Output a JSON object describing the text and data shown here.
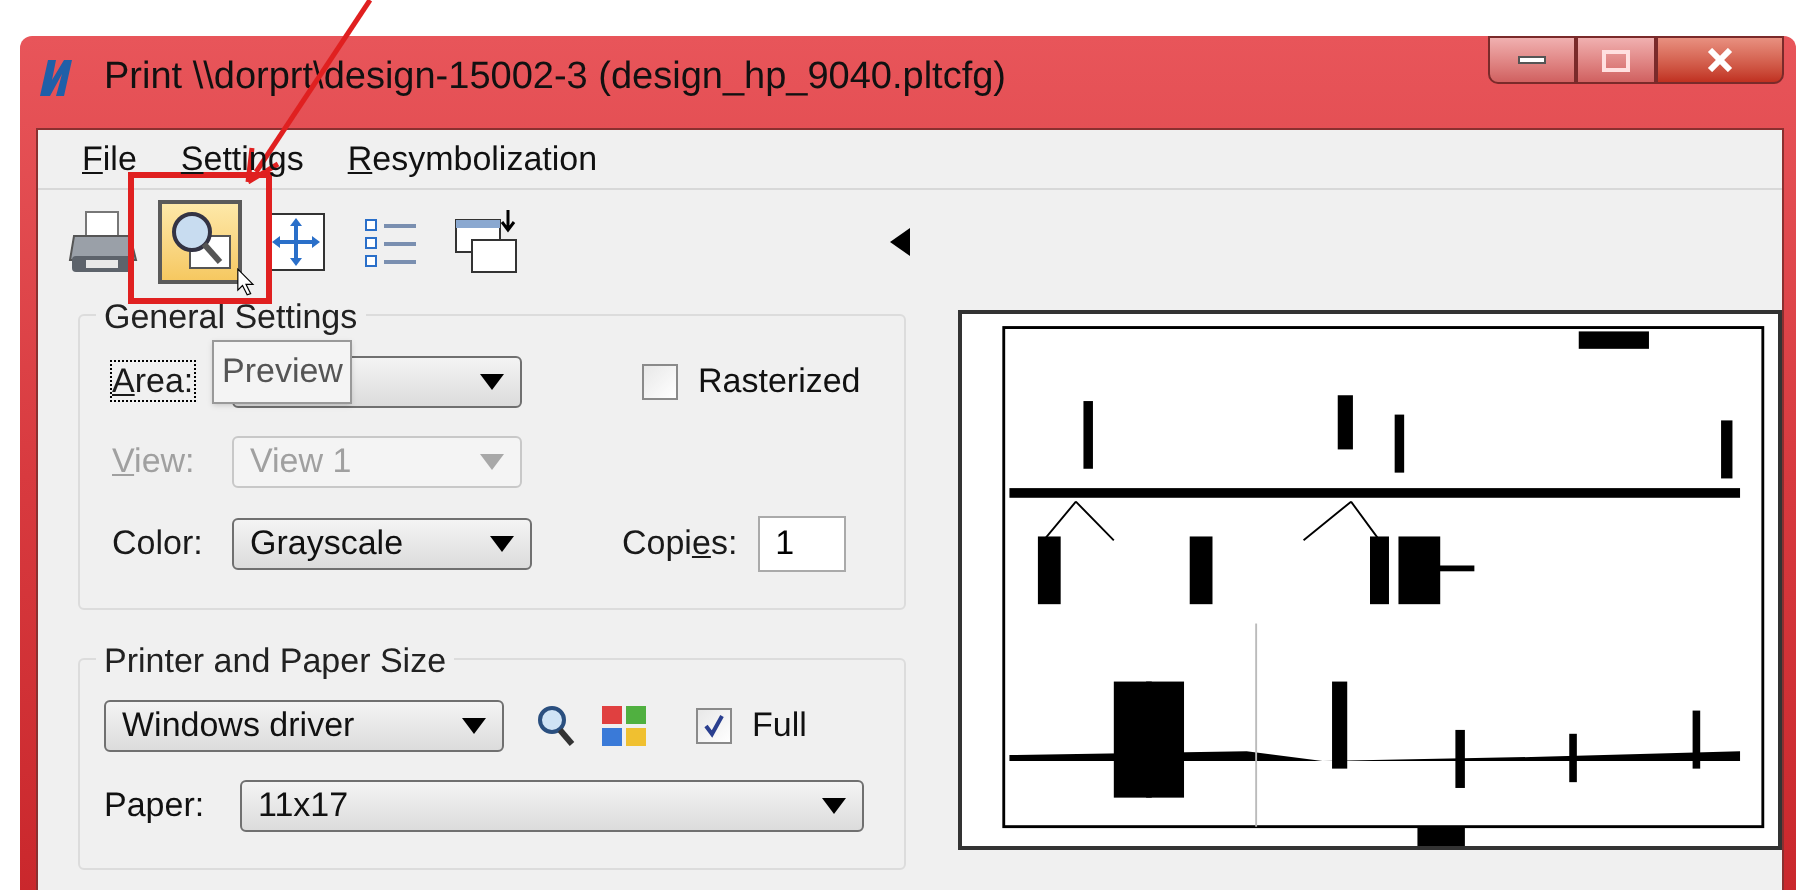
{
  "window": {
    "title": "Print  \\\\dorprt\\design-15002-3  (design_hp_9040.pltcfg)"
  },
  "menu": [
    {
      "key": "F",
      "rest": "ile"
    },
    {
      "key": "S",
      "rest": "ettings"
    },
    {
      "key": "R",
      "rest": "esymbolization"
    }
  ],
  "toolbar": [
    {
      "kind": "print",
      "selected": false
    },
    {
      "kind": "preview",
      "selected": true
    },
    {
      "kind": "fit",
      "selected": false
    },
    {
      "kind": "list",
      "selected": false
    },
    {
      "kind": "swap",
      "selected": false
    }
  ],
  "tooltip": "Preview",
  "general_settings": {
    "title": "General Settings",
    "area": {
      "label": {
        "key": "A",
        "after": "rea:"
      },
      "focused": true
    },
    "rasterized": {
      "label": "Rasterized",
      "checked": false
    },
    "view": {
      "label": {
        "key": "V",
        "after": "iew:"
      },
      "value": "View 1",
      "disabled": true
    },
    "color": {
      "label": {
        "before": "Color:"
      },
      "value": "Grayscale",
      "disabled": false
    },
    "copies": {
      "label": {
        "before": "Copi",
        "key": "e",
        "after": "s:"
      },
      "value": "1"
    }
  },
  "printer_paper": {
    "title": "Printer and Paper Size",
    "driver": "Windows driver",
    "full": {
      "label": "Full",
      "checked": true
    },
    "paper": {
      "label": "Paper:",
      "value": "11x17"
    }
  }
}
